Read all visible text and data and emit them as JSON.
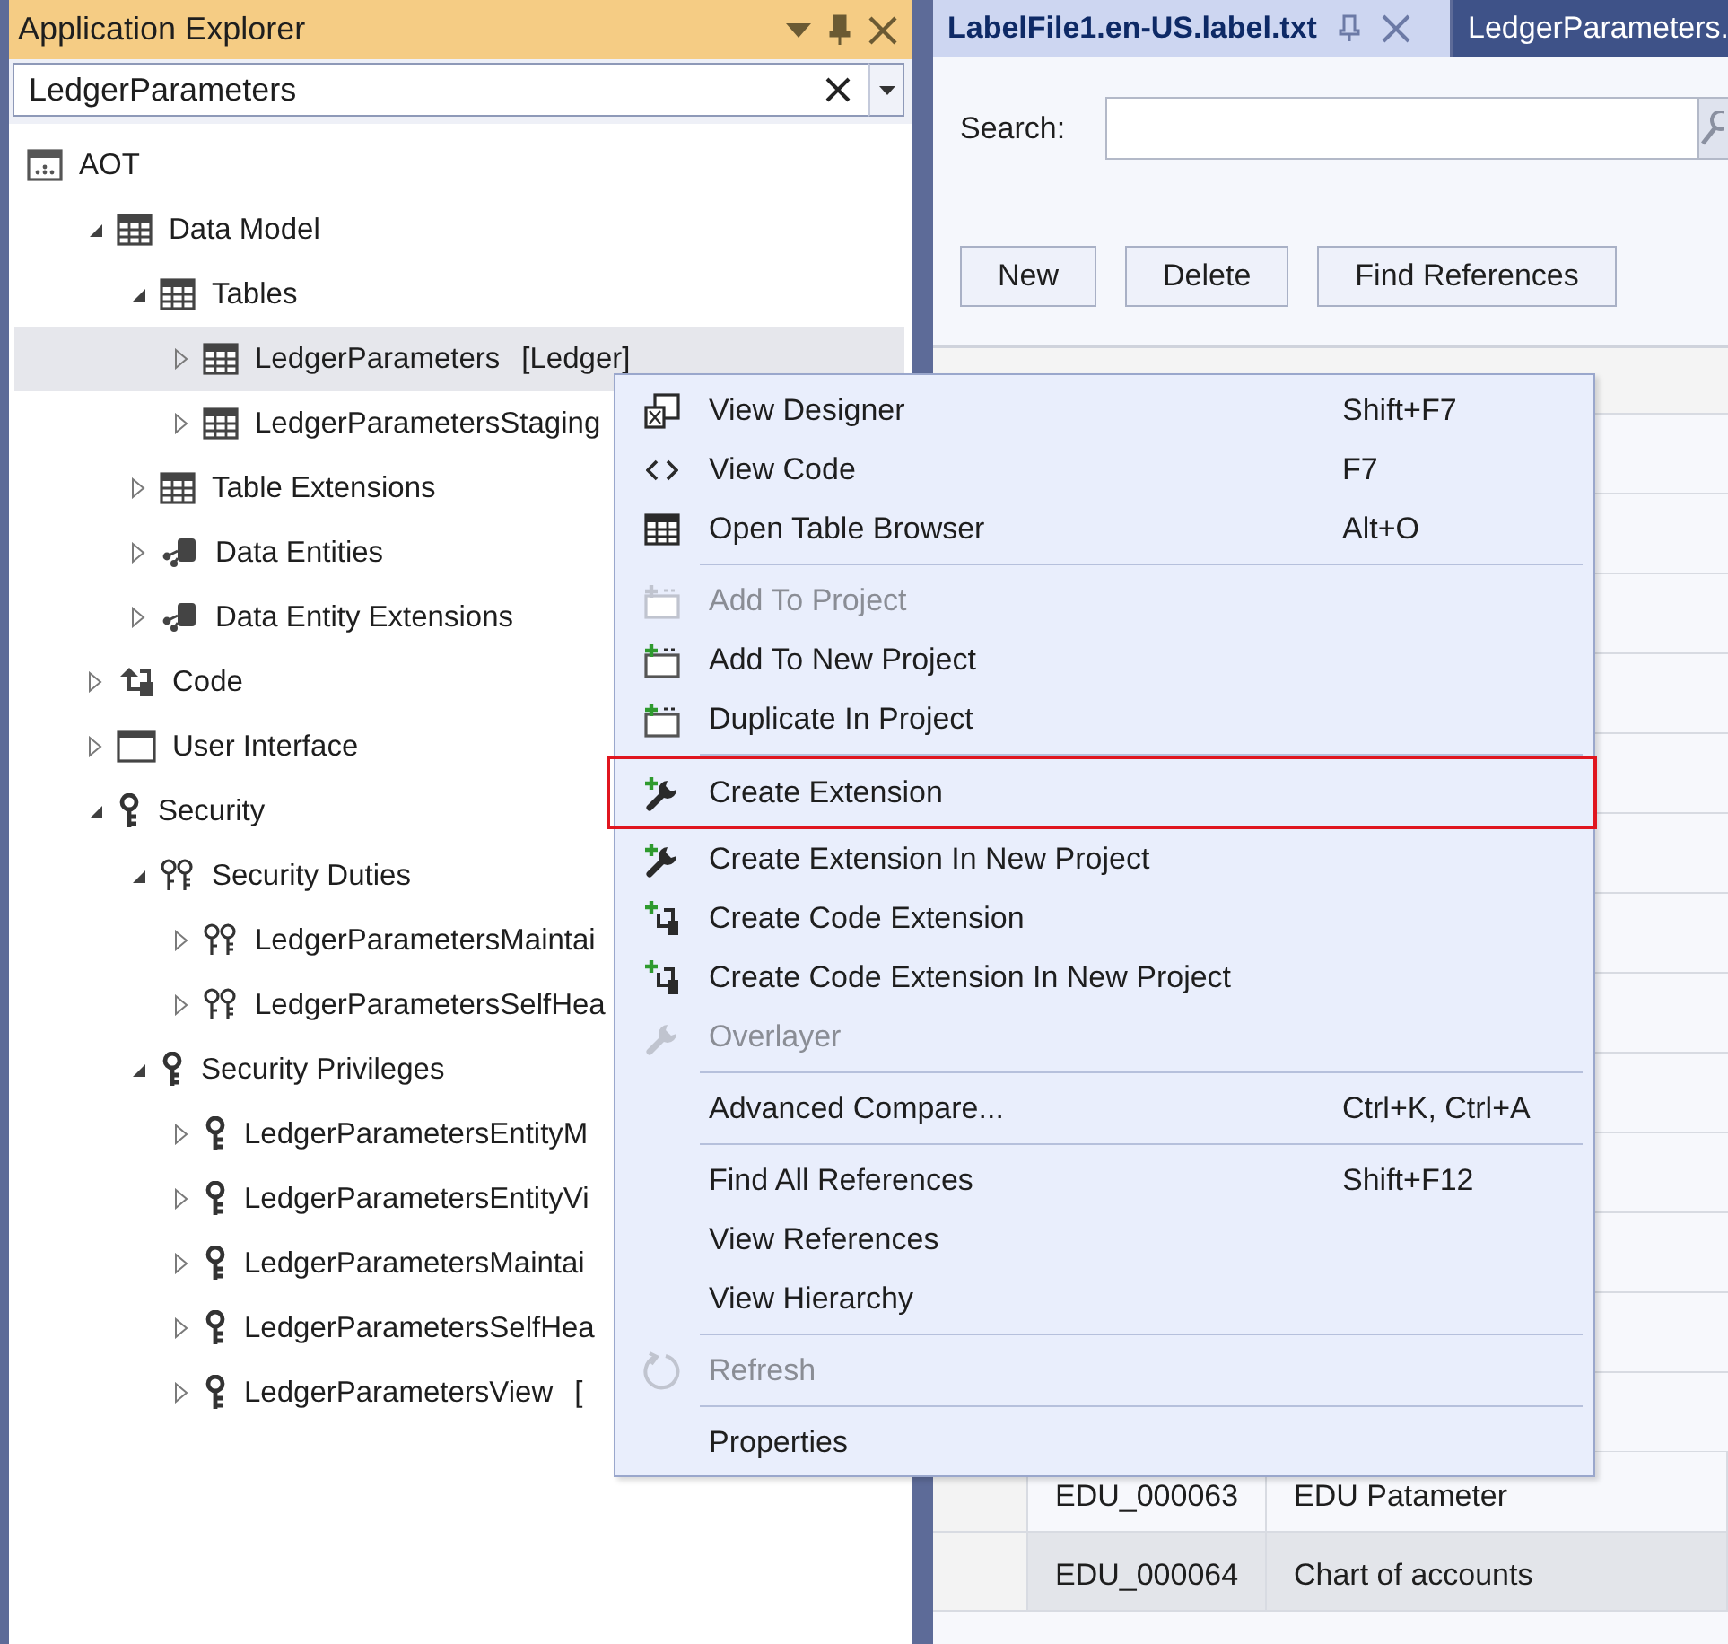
{
  "explorer": {
    "title": "Application Explorer",
    "search": {
      "value": "LedgerParameters"
    },
    "tree": [
      {
        "label": "AOT",
        "kind": "root",
        "selected": false,
        "children": [
          {
            "label": "Data Model",
            "kind": "table",
            "expanded": true,
            "selected": false,
            "children": [
              {
                "label": "Tables",
                "kind": "table",
                "expanded": true,
                "selected": false,
                "children": [
                  {
                    "label": "LedgerParameters",
                    "suffix": "[Ledger]",
                    "kind": "table",
                    "expanded": false,
                    "selected": true
                  },
                  {
                    "label": "LedgerParametersStaging",
                    "kind": "table",
                    "expanded": false,
                    "selected": false
                  }
                ]
              },
              {
                "label": "Table Extensions",
                "kind": "table",
                "expanded": false,
                "selected": false
              },
              {
                "label": "Data Entities",
                "kind": "entity",
                "expanded": false,
                "selected": false
              },
              {
                "label": "Data Entity Extensions",
                "kind": "entity",
                "expanded": false,
                "selected": false
              }
            ]
          },
          {
            "label": "Code",
            "kind": "code",
            "expanded": false,
            "selected": false
          },
          {
            "label": "User Interface",
            "kind": "form",
            "expanded": false,
            "selected": false
          },
          {
            "label": "Security",
            "kind": "key",
            "expanded": true,
            "selected": false,
            "children": [
              {
                "label": "Security Duties",
                "kind": "keys",
                "expanded": true,
                "selected": false,
                "children": [
                  {
                    "label": "LedgerParametersMaintai",
                    "kind": "keys",
                    "expanded": false,
                    "selected": false
                  },
                  {
                    "label": "LedgerParametersSelfHea",
                    "kind": "keys",
                    "expanded": false,
                    "selected": false
                  }
                ]
              },
              {
                "label": "Security Privileges",
                "kind": "key",
                "expanded": true,
                "selected": false,
                "children": [
                  {
                    "label": "LedgerParametersEntityM",
                    "kind": "key",
                    "expanded": false,
                    "selected": false
                  },
                  {
                    "label": "LedgerParametersEntityVi",
                    "kind": "key",
                    "expanded": false,
                    "selected": false
                  },
                  {
                    "label": "LedgerParametersMaintai",
                    "kind": "key",
                    "expanded": false,
                    "selected": false
                  },
                  {
                    "label": "LedgerParametersSelfHea",
                    "kind": "key",
                    "expanded": false,
                    "selected": false
                  },
                  {
                    "label": "LedgerParametersView",
                    "suffix": "[",
                    "kind": "key",
                    "expanded": false,
                    "selected": false
                  }
                ]
              }
            ]
          }
        ]
      }
    ]
  },
  "tabs": [
    {
      "label": "LabelFile1.en-US.label.txt",
      "selected": true
    },
    {
      "label": "LedgerParameters.",
      "selected": false
    }
  ],
  "label_editor": {
    "search_label": "Search:",
    "buttons": [
      "New",
      "Delete",
      "Find References"
    ],
    "rows": [
      {
        "label_id": "EDU_000063",
        "label": "EDU Patameter",
        "selected": false
      },
      {
        "label_id": "EDU_000064",
        "label": "Chart of accounts",
        "selected": true
      }
    ]
  },
  "context_menu": [
    {
      "kind": "designer",
      "label": "View Designer",
      "shortcut": "Shift+F7",
      "disabled": false,
      "highlighted": false
    },
    {
      "kind": "code",
      "label": "View Code",
      "shortcut": "F7",
      "disabled": false,
      "highlighted": false
    },
    {
      "kind": "grid",
      "label": "Open Table Browser",
      "shortcut": "Alt+O",
      "disabled": false,
      "highlighted": false
    },
    {
      "kind": "separator"
    },
    {
      "kind": "add",
      "label": "Add To Project",
      "disabled": true,
      "highlighted": false
    },
    {
      "kind": "add",
      "label": "Add To New Project",
      "disabled": false,
      "highlighted": false
    },
    {
      "kind": "add",
      "label": "Duplicate In Project",
      "disabled": false,
      "highlighted": false
    },
    {
      "kind": "separator"
    },
    {
      "kind": "wrench",
      "label": "Create Extension",
      "disabled": false,
      "highlighted": true
    },
    {
      "kind": "wrench",
      "label": "Create Extension In New Project",
      "disabled": false,
      "highlighted": false
    },
    {
      "kind": "branch",
      "label": "Create Code Extension",
      "disabled": false,
      "highlighted": false
    },
    {
      "kind": "branch",
      "label": "Create Code Extension In New Project",
      "disabled": false,
      "highlighted": false
    },
    {
      "kind": "wrench",
      "label": "Overlayer",
      "disabled": true,
      "highlighted": false
    },
    {
      "kind": "separator"
    },
    {
      "kind": "plain",
      "label": "Advanced Compare...",
      "shortcut": "Ctrl+K, Ctrl+A",
      "disabled": false,
      "highlighted": false
    },
    {
      "kind": "separator"
    },
    {
      "kind": "plain",
      "label": "Find All References",
      "shortcut": "Shift+F12",
      "disabled": false,
      "highlighted": false
    },
    {
      "kind": "plain",
      "label": "View References",
      "disabled": false,
      "highlighted": false
    },
    {
      "kind": "plain",
      "label": "View Hierarchy",
      "disabled": false,
      "highlighted": false
    },
    {
      "kind": "separator"
    },
    {
      "kind": "refresh",
      "label": "Refresh",
      "disabled": true,
      "highlighted": false
    },
    {
      "kind": "separator"
    },
    {
      "kind": "plain",
      "label": "Properties",
      "disabled": false,
      "highlighted": false
    }
  ]
}
